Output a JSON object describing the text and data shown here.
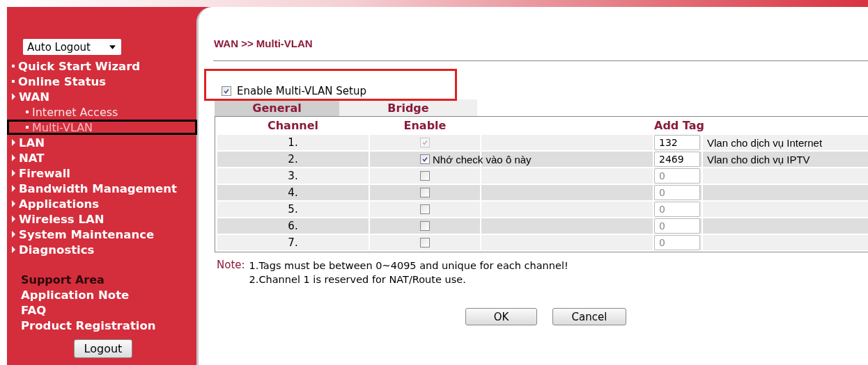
{
  "sidebar": {
    "auto_logout": {
      "value": "Auto Logout"
    },
    "items": [
      {
        "label": "Quick Start Wizard",
        "kind": "bullet",
        "selected": false,
        "highlighted": false
      },
      {
        "label": "Online Status",
        "kind": "bullet",
        "selected": false,
        "highlighted": false
      },
      {
        "label": "WAN",
        "kind": "arrow",
        "selected": false,
        "highlighted": false,
        "children": [
          {
            "label": "Internet Access",
            "kind": "bullet",
            "selected": false,
            "highlighted": false
          },
          {
            "label": "Multi-VLAN",
            "kind": "bullet",
            "selected": true,
            "highlighted": true
          }
        ]
      },
      {
        "label": "LAN",
        "kind": "arrow",
        "selected": false,
        "highlighted": false
      },
      {
        "label": "NAT",
        "kind": "arrow",
        "selected": false,
        "highlighted": false
      },
      {
        "label": "Firewall",
        "kind": "arrow",
        "selected": false,
        "highlighted": false
      },
      {
        "label": "Bandwidth Management",
        "kind": "arrow",
        "selected": false,
        "highlighted": false
      },
      {
        "label": "Applications",
        "kind": "arrow",
        "selected": false,
        "highlighted": false
      },
      {
        "label": "Wireless LAN",
        "kind": "arrow",
        "selected": false,
        "highlighted": false
      },
      {
        "label": "System Maintenance",
        "kind": "arrow",
        "selected": false,
        "highlighted": false
      },
      {
        "label": "Diagnostics",
        "kind": "arrow",
        "selected": false,
        "highlighted": false
      }
    ],
    "support_title": "Support Area",
    "support_links": [
      "Application Note",
      "FAQ",
      "Product Registration"
    ],
    "logout_button": "Logout"
  },
  "page_title": "WAN >> Multi-VLAN",
  "enable_multi_vlan": {
    "label": "Enable Multi-VLAN Setup",
    "checked": true,
    "highlighted": true
  },
  "tabs": [
    {
      "label": "General",
      "selected": true
    },
    {
      "label": "Bridge",
      "selected": false
    }
  ],
  "table": {
    "columns": [
      "Channel",
      "Enable",
      "Add Tag"
    ],
    "rows": [
      {
        "channel": "1.",
        "enabled": true,
        "disabled": true,
        "tag": {
          "value": "132"
        },
        "description": "Vlan cho dịch vụ Internet"
      },
      {
        "channel": "2.",
        "enabled": true,
        "disabled": false,
        "note": "Nhớ check vào ô này",
        "tag": {
          "value": "2469"
        },
        "description": "Vlan cho dich vụ IPTV"
      },
      {
        "channel": "3.",
        "enabled": false,
        "disabled": false,
        "tag": {
          "placeholder": "0"
        }
      },
      {
        "channel": "4.",
        "enabled": false,
        "disabled": false,
        "tag": {
          "placeholder": "0"
        }
      },
      {
        "channel": "5.",
        "enabled": false,
        "disabled": false,
        "tag": {
          "placeholder": "0"
        }
      },
      {
        "channel": "6.",
        "enabled": false,
        "disabled": false,
        "tag": {
          "placeholder": "0"
        }
      },
      {
        "channel": "7.",
        "enabled": false,
        "disabled": false,
        "tag": {
          "placeholder": "0"
        }
      }
    ]
  },
  "note": {
    "label": "Note:",
    "lines": [
      "1.Tags must be between 0~4095 and unique for each channel!",
      "2.Channel 1 is reserved for NAT/Route use."
    ]
  },
  "buttons": [
    "OK",
    "Cancel"
  ]
}
